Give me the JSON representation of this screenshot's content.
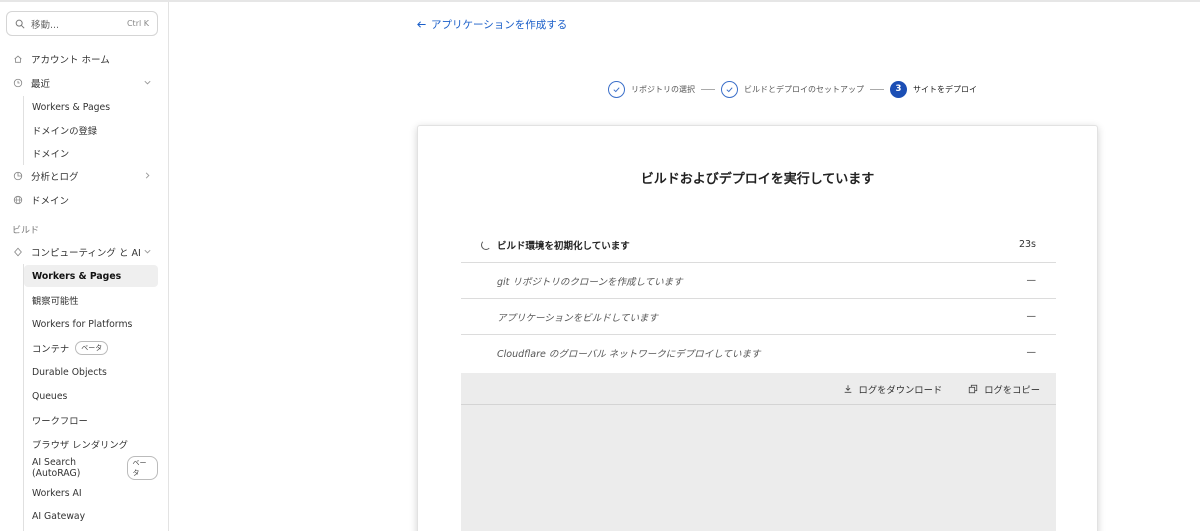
{
  "sidebar": {
    "search_placeholder": "移動...",
    "search_shortcut": "Ctrl K",
    "account_home": "アカウント ホーム",
    "recent": "最近",
    "recent_items": [
      "Workers & Pages",
      "ドメインの登録",
      "ドメイン"
    ],
    "analytics": "分析とログ",
    "domains": "ドメイン",
    "section_build": "ビルド",
    "compute_ai": "コンピューティング と AI",
    "compute_items": [
      {
        "label": "Workers & Pages",
        "badge": ""
      },
      {
        "label": "観察可能性",
        "badge": ""
      },
      {
        "label": "Workers for Platforms",
        "badge": ""
      },
      {
        "label": "コンテナ",
        "badge": "ベータ"
      },
      {
        "label": "Durable Objects",
        "badge": ""
      },
      {
        "label": "Queues",
        "badge": ""
      },
      {
        "label": "ワークフロー",
        "badge": ""
      },
      {
        "label": "ブラウザ レンダリング",
        "badge": ""
      },
      {
        "label": "AI Search (AutoRAG)",
        "badge": "ベータ"
      },
      {
        "label": "Workers AI",
        "badge": ""
      },
      {
        "label": "AI Gateway",
        "badge": ""
      }
    ]
  },
  "main": {
    "back_link": "アプリケーションを作成する",
    "steps": [
      {
        "label": "リポジトリの選択",
        "state": "done"
      },
      {
        "label": "ビルドとデプロイのセットアップ",
        "state": "done"
      },
      {
        "label": "サイトをデプロイ",
        "state": "current",
        "number": "3"
      }
    ],
    "card_title": "ビルドおよびデプロイを実行しています",
    "tasks": [
      {
        "label": "ビルド環境を初期化しています",
        "value": "23s"
      },
      {
        "label": "git リポジトリのクローンを作成しています",
        "value": "—"
      },
      {
        "label": "アプリケーションをビルドしています",
        "value": "—"
      },
      {
        "label": "Cloudflare のグローバル ネットワークにデプロイしています",
        "value": "—"
      }
    ],
    "download_logs": "ログをダウンロード",
    "copy_logs": "ログをコピー"
  }
}
